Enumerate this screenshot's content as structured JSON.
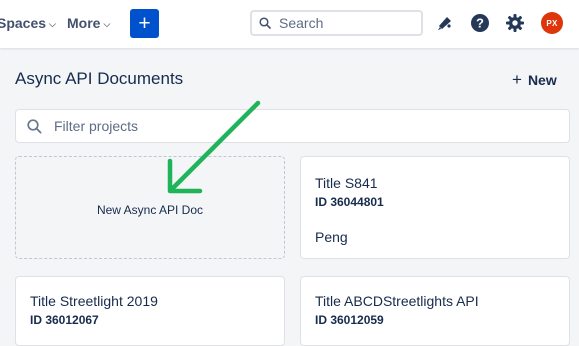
{
  "nav": {
    "spaces_label": "Spaces",
    "more_label": "More",
    "create_label": "+"
  },
  "search": {
    "placeholder": "Search"
  },
  "user": {
    "initials": "PX",
    "avatar_color": "#de350b"
  },
  "page": {
    "title": "Async API Documents",
    "new_label": "New",
    "filter_placeholder": "Filter projects"
  },
  "new_card": {
    "label": "New Async API Doc"
  },
  "cards": [
    {
      "title": "Title S841",
      "id": "ID 36044801",
      "owner": "Peng"
    },
    {
      "title": "Title Streetlight 2019",
      "id": "ID 36012067"
    },
    {
      "title": "Title ABCDStreetlights API",
      "id": "ID 36012059"
    }
  ],
  "colors": {
    "accent": "#0052cc",
    "annotation_arrow": "#1fb35a"
  },
  "icons": [
    "chevron-down-icon",
    "search-icon",
    "megaphone-icon",
    "help-icon",
    "gear-icon",
    "plus-icon",
    "arrow-annotation"
  ]
}
